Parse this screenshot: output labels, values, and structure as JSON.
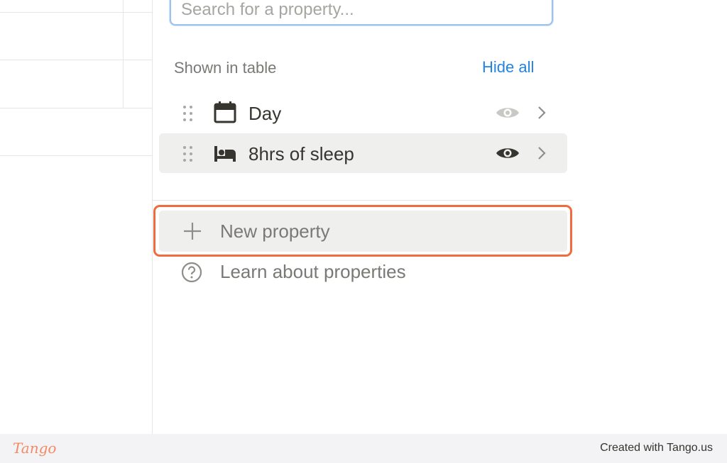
{
  "search": {
    "placeholder": "Search for a property..."
  },
  "section": {
    "title": "Shown in table",
    "hide_all_label": "Hide all"
  },
  "properties": [
    {
      "label": "Day",
      "icon": "calendar-icon",
      "visible": true
    },
    {
      "label": "8hrs of sleep",
      "icon": "bed-icon",
      "visible": true
    }
  ],
  "actions": {
    "new_property_label": "New property",
    "learn_label": "Learn about properties"
  },
  "footer": {
    "logo_text": "Tango",
    "created_text": "Created with Tango.us"
  },
  "colors": {
    "accent_blue": "#2383e2",
    "highlight_orange": "#f06b3d",
    "hover_bg": "#efefee",
    "muted_text": "#7a7975"
  }
}
